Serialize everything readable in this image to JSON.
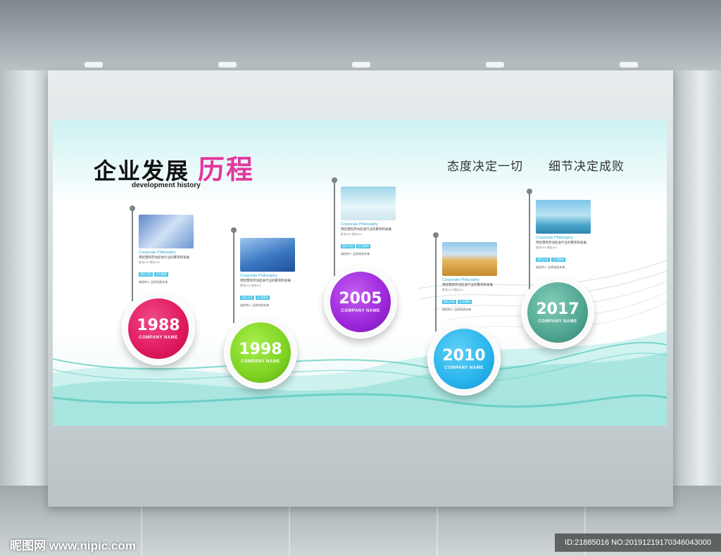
{
  "title": {
    "main": "企业发展",
    "accent": "历程",
    "subtitle": "development history"
  },
  "mottos": [
    "态度决定一切",
    "细节决定成败"
  ],
  "milestones": [
    {
      "year": "1988",
      "company": "COMPANY NAME",
      "color": "#e0185e",
      "photo": "handshake-photo"
    },
    {
      "year": "1998",
      "company": "COMPANY NAME",
      "color": "#7ed321",
      "photo": "building-photo"
    },
    {
      "year": "2005",
      "company": "COMPANY NAME",
      "color": "#9b27d9",
      "photo": "businessman-photo"
    },
    {
      "year": "2010",
      "company": "COMPANY NAME",
      "color": "#28b4ec",
      "photo": "wheat-photo"
    },
    {
      "year": "2017",
      "company": "COMPANY NAME",
      "color": "#4fa590",
      "photo": "city-photo"
    }
  ],
  "card": {
    "philosophy": "Corporate Philosophy",
    "desc": "用智慧和劳动促进行业的繁荣和发展",
    "meta": "姓名/XX 地址/XX",
    "tags": [
      "团队风采",
      "企业精神"
    ],
    "note": "诚信待人 品质创造未来"
  },
  "watermark": "昵图网 www.nipic.com",
  "image_id": "ID:21885016 NO:20191219170346043000"
}
